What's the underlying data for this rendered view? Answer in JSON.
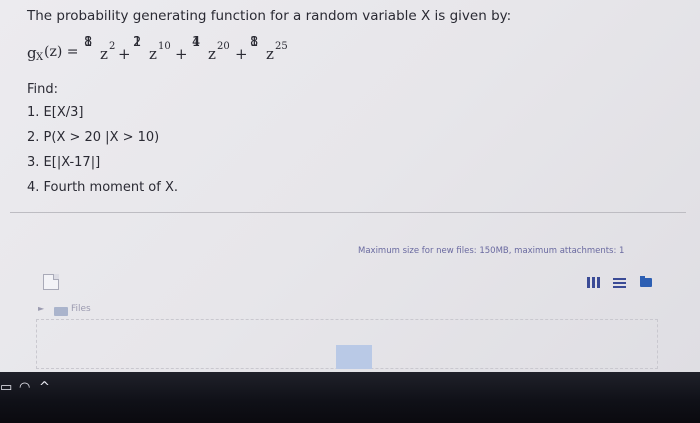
{
  "question": {
    "intro": "The probability generating function for a random variable X is given by:",
    "formula": {
      "lhs": "g",
      "lhs_sub": "X",
      "lhs_arg": "(z) =",
      "terms": [
        {
          "num": "1",
          "den": "8",
          "power": "2"
        },
        {
          "num": "1",
          "den": "2",
          "power": "10"
        },
        {
          "num": "1",
          "den": "4",
          "power": "20"
        },
        {
          "num": "1",
          "den": "8",
          "power": "25"
        }
      ],
      "var": "z",
      "plus": "+"
    },
    "find_label": "Find:",
    "items": [
      "1. E[X/3]",
      "2. P(X > 20 |X > 10)",
      "3. E[|X-17|]",
      "4. Fourth moment of X."
    ]
  },
  "attachments": {
    "max_size_text": "Maximum size for new files: 150MB, maximum attachments: 1",
    "files_label": "Files",
    "files_arrow": "►"
  },
  "taskbar": {
    "icons": [
      "battery-icon",
      "wifi-icon",
      "chevron-up-icon"
    ],
    "glyphs": [
      "▭",
      "◠",
      "^"
    ]
  }
}
